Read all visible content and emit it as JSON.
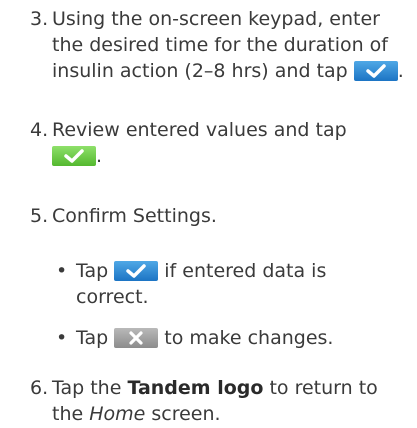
{
  "steps": [
    {
      "number": "3.",
      "line1": "Using the on-screen keypad, enter",
      "line2": "the desired time for the duration of",
      "line3": "insulin action (2–8 hrs) and tap",
      "end": "."
    },
    {
      "number": "4.",
      "line1": "Review entered values and tap",
      "end": "."
    },
    {
      "number": "5.",
      "line1": "Confirm Settings."
    },
    {
      "number": "6.",
      "line1_pre": "Tap the ",
      "line1_bold": "Tandem logo",
      "line1_post": " to return to",
      "line2_pre": "the ",
      "line2_ital": "Home",
      "line2_post": " screen."
    }
  ],
  "bullets": [
    {
      "pre": "Tap",
      "post": "if entered data is",
      "line2": "correct."
    },
    {
      "pre": "Tap",
      "post": "to make changes."
    }
  ],
  "icons": {
    "check_blue": "check-icon",
    "check_green": "check-icon",
    "close_grey": "close-icon",
    "colors": {
      "blue": "#2a86d6",
      "green": "#6ccc45",
      "grey": "#9e9e9e"
    }
  }
}
